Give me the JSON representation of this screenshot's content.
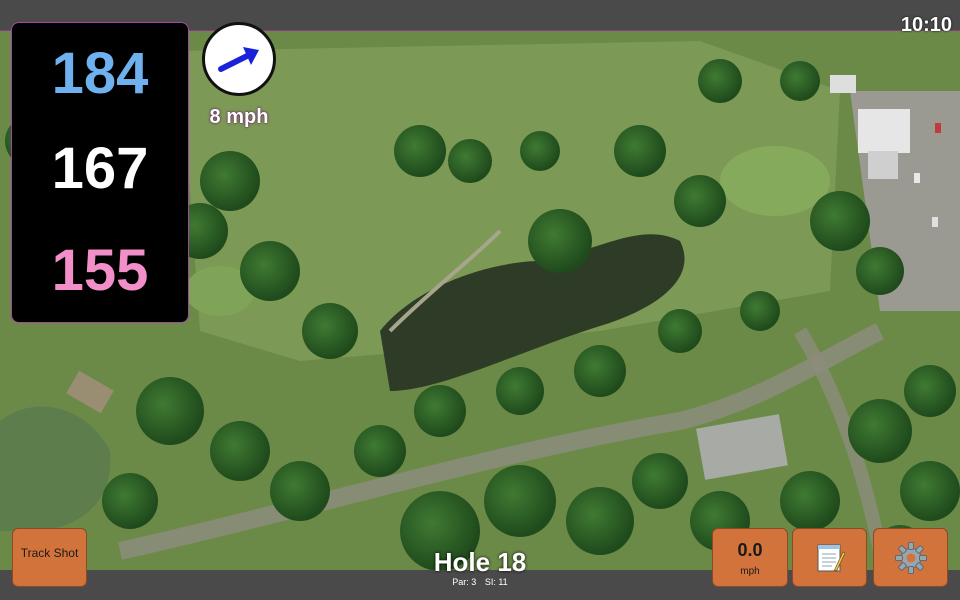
{
  "status": {
    "time": "10:10"
  },
  "distances": {
    "back": "184",
    "middle": "167",
    "front": "155"
  },
  "wind": {
    "speed": "8 mph",
    "direction_icon": "arrow-right-icon"
  },
  "hole": {
    "title": "Hole 18",
    "par": "Par: 3",
    "stroke_index": "SI: 11"
  },
  "buttons": {
    "track_shot": "Track Shot",
    "speed_value": "0.0",
    "speed_unit": "mph",
    "notes_icon": "notepad-icon",
    "settings_icon": "gear-icon"
  },
  "colors": {
    "back_distance": "#6fb1ee",
    "middle_distance": "#ffffff",
    "front_distance": "#f28fc8",
    "button_bg": "#d2733c",
    "panel_border": "#a24aa2",
    "wind_arrow": "#1a22d9"
  }
}
